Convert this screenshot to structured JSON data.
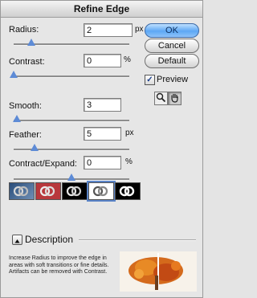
{
  "window": {
    "title": "Refine Edge"
  },
  "controls": {
    "radius": {
      "label": "Radius:",
      "value": "2",
      "unit": "px",
      "slider": 0.15
    },
    "contrast": {
      "label": "Contrast:",
      "value": "0",
      "unit": "%",
      "slider": 0.0
    },
    "smooth": {
      "label": "Smooth:",
      "value": "3",
      "unit": "",
      "slider": 0.03
    },
    "feather": {
      "label": "Feather:",
      "value": "5",
      "unit": "px",
      "slider": 0.18
    },
    "contract": {
      "label": "Contract/Expand:",
      "value": "0",
      "unit": "%",
      "slider": 0.5,
      "minus": "−",
      "plus": "+"
    }
  },
  "buttons": {
    "ok": "OK",
    "cancel": "Cancel",
    "default": "Default"
  },
  "preview": {
    "label": "Preview",
    "checked": true
  },
  "tools": [
    "zoom-tool",
    "hand-tool"
  ],
  "view_modes": [
    "standard",
    "quick-mask",
    "on-black",
    "on-white",
    "mask"
  ],
  "description": {
    "heading": "Description",
    "text": "Increase Radius to improve the edge in areas with soft transitions or fine details. Artifacts can be removed with Contrast."
  },
  "colors": {
    "accent": "#5d8bd6",
    "ok_button": "#5da7f4"
  }
}
